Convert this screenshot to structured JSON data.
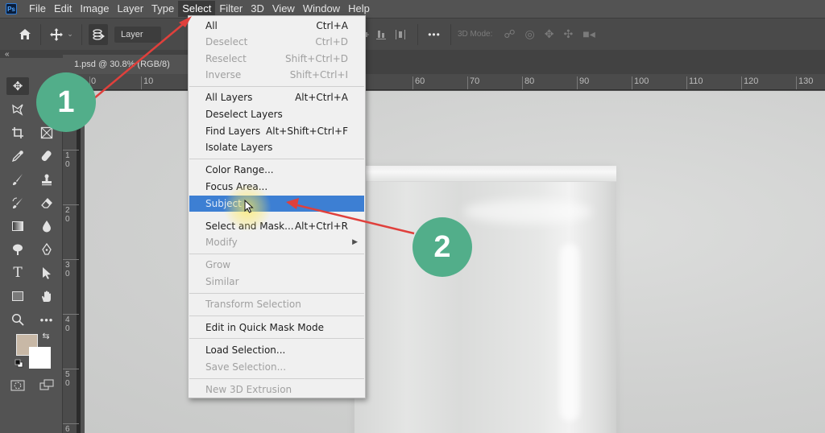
{
  "menubar": {
    "logo": "Ps",
    "items": [
      "File",
      "Edit",
      "Image",
      "Layer",
      "Type",
      "Select",
      "Filter",
      "3D",
      "View",
      "Window",
      "Help"
    ],
    "active": "Select"
  },
  "options_bar": {
    "home_icon": "home-icon",
    "move_icon": "move-icon",
    "layer_dropdown": "Layer",
    "more_label": "•••",
    "mode_3d_label": "3D Mode:"
  },
  "document": {
    "tab_title": "1.psd @ 30.8% (RGB/8)"
  },
  "rulers": {
    "top_labels": [
      "0",
      "10",
      "60",
      "70",
      "80",
      "90",
      "100",
      "110",
      "120",
      "130"
    ],
    "left_labels": [
      "1 0",
      "2 0",
      "3 0",
      "4 0",
      "5 0",
      "6"
    ]
  },
  "tools": {
    "foreground_color": "#c8b8a6",
    "background_color": "#ffffff"
  },
  "select_menu": {
    "items": [
      {
        "label": "All",
        "shortcut": "Ctrl+A",
        "enabled": true
      },
      {
        "label": "Deselect",
        "shortcut": "Ctrl+D",
        "enabled": false
      },
      {
        "label": "Reselect",
        "shortcut": "Shift+Ctrl+D",
        "enabled": false
      },
      {
        "label": "Inverse",
        "shortcut": "Shift+Ctrl+I",
        "enabled": false
      },
      {
        "label": "All Layers",
        "shortcut": "Alt+Ctrl+A",
        "enabled": true
      },
      {
        "label": "Deselect Layers",
        "shortcut": "",
        "enabled": true
      },
      {
        "label": "Find Layers",
        "shortcut": "Alt+Shift+Ctrl+F",
        "enabled": true
      },
      {
        "label": "Isolate Layers",
        "shortcut": "",
        "enabled": true
      },
      {
        "label": "Color Range...",
        "shortcut": "",
        "enabled": true
      },
      {
        "label": "Focus Area...",
        "shortcut": "",
        "enabled": true
      },
      {
        "label": "Subject",
        "shortcut": "",
        "enabled": true,
        "highlighted": true
      },
      {
        "label": "Select and Mask...",
        "shortcut": "Alt+Ctrl+R",
        "enabled": true
      },
      {
        "label": "Modify",
        "shortcut": "",
        "enabled": false,
        "submenu": true
      },
      {
        "label": "Grow",
        "shortcut": "",
        "enabled": false
      },
      {
        "label": "Similar",
        "shortcut": "",
        "enabled": false
      },
      {
        "label": "Transform Selection",
        "shortcut": "",
        "enabled": false
      },
      {
        "label": "Edit in Quick Mask Mode",
        "shortcut": "",
        "enabled": true
      },
      {
        "label": "Load Selection...",
        "shortcut": "",
        "enabled": true
      },
      {
        "label": "Save Selection...",
        "shortcut": "",
        "enabled": false
      },
      {
        "label": "New 3D Extrusion",
        "shortcut": "",
        "enabled": false
      }
    ],
    "highlight_color": "#3d7fd3"
  },
  "annotations": {
    "step1": "1",
    "step2": "2",
    "badge_color": "#52ae8a",
    "arrow_color": "#e0403c"
  }
}
